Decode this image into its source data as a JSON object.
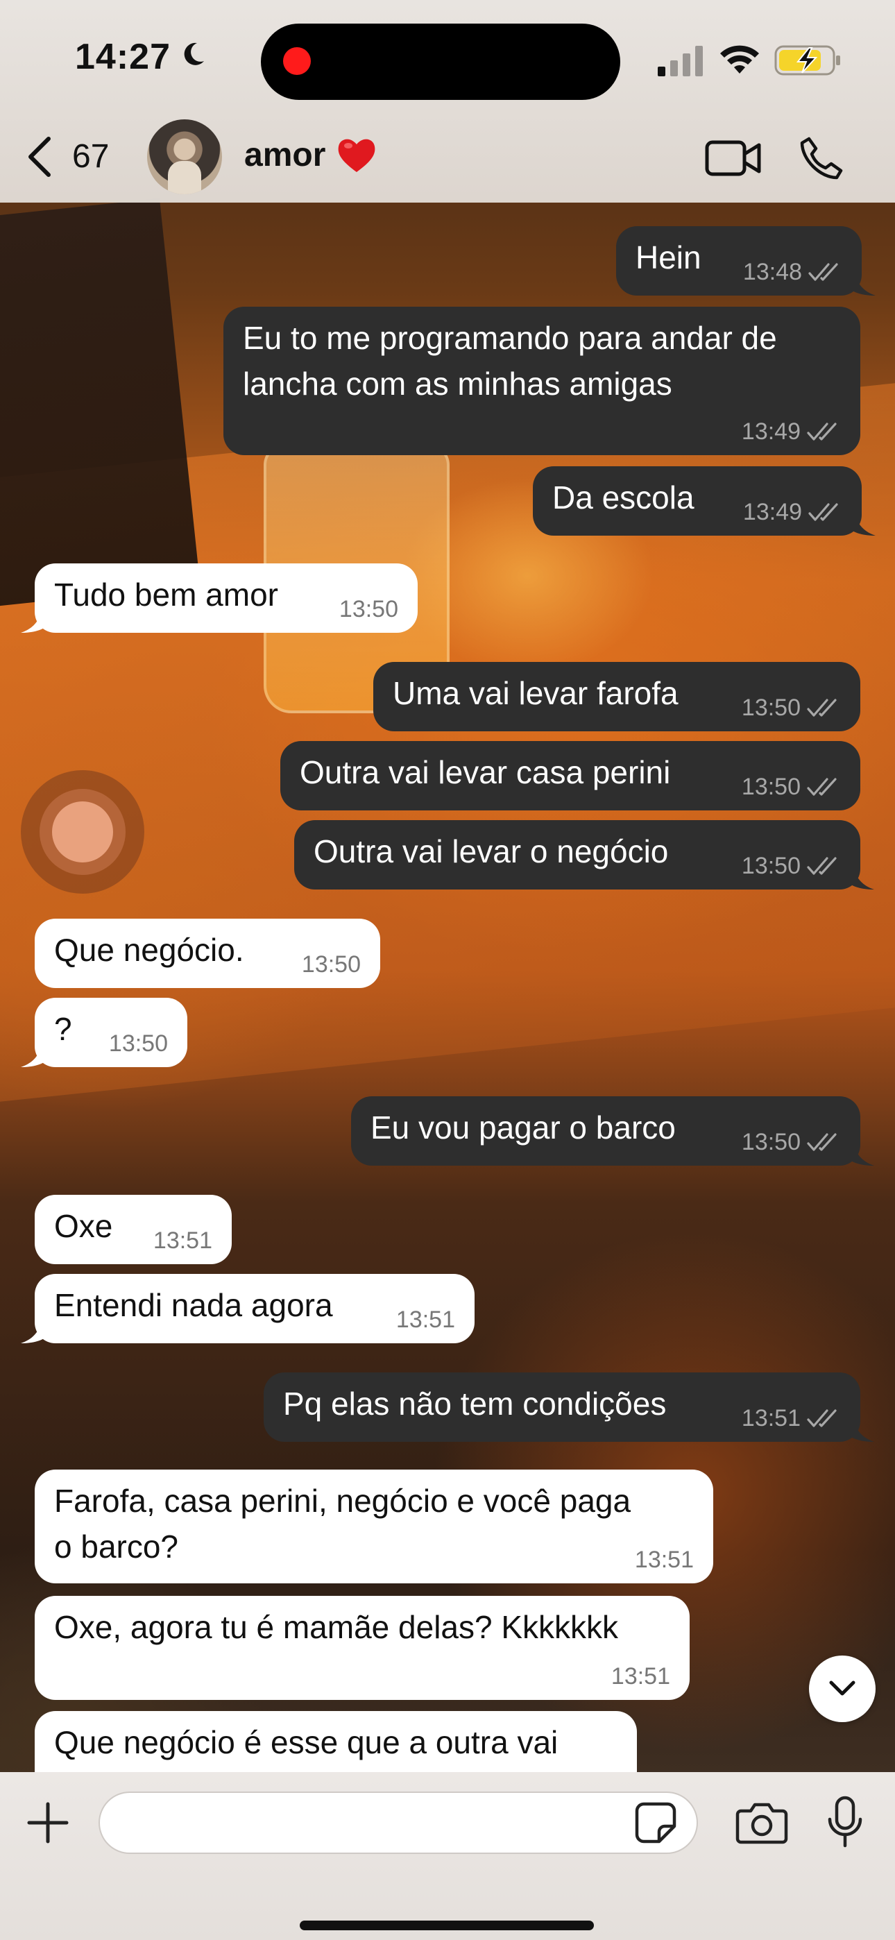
{
  "status_bar": {
    "time": "14:27",
    "recording": true
  },
  "header": {
    "back_count": "67",
    "contact_name": "amor",
    "contact_emoji": "heart-icon"
  },
  "messages": [
    {
      "dir": "out",
      "text": "Hein",
      "time": "13:48",
      "read": true
    },
    {
      "dir": "out",
      "lines": [
        "Eu to me programando para andar de",
        "lancha com as minhas amigas"
      ],
      "time": "13:49",
      "read": true
    },
    {
      "dir": "out",
      "text": "Da escola",
      "time": "13:49",
      "read": true
    },
    {
      "dir": "in",
      "text": "Tudo bem amor",
      "time": "13:50"
    },
    {
      "dir": "out",
      "text": "Uma vai levar farofa",
      "time": "13:50",
      "read": true
    },
    {
      "dir": "out",
      "text": "Outra vai levar casa perini",
      "time": "13:50",
      "read": true
    },
    {
      "dir": "out",
      "text": "Outra vai levar o negócio",
      "time": "13:50",
      "read": true
    },
    {
      "dir": "in",
      "text": "Que negócio.",
      "time": "13:50"
    },
    {
      "dir": "in",
      "text": "?",
      "time": "13:50"
    },
    {
      "dir": "out",
      "text": "Eu vou pagar o barco",
      "time": "13:50",
      "read": true
    },
    {
      "dir": "in",
      "text": "Oxe",
      "time": "13:51"
    },
    {
      "dir": "in",
      "text": "Entendi nada agora",
      "time": "13:51"
    },
    {
      "dir": "out",
      "text": "Pq elas não tem condições",
      "time": "13:51",
      "read": true
    },
    {
      "dir": "in",
      "lines": [
        "Farofa, casa perini, negócio e você paga",
        "o barco?"
      ],
      "time": "13:51"
    },
    {
      "dir": "in",
      "text": "Oxe, agora tu é mamãe delas? Kkkkkkk",
      "time": "13:51"
    },
    {
      "dir": "in",
      "text": "Que negócio é esse que a outra vai",
      "time": ""
    }
  ],
  "composer": {
    "value": "",
    "placeholder": ""
  },
  "colors": {
    "outgoing_bubble": "#2e2e2e",
    "incoming_bubble": "#ffffff",
    "rec_dot": "#ff1b1b",
    "battery_fill": "#f5d42a"
  }
}
